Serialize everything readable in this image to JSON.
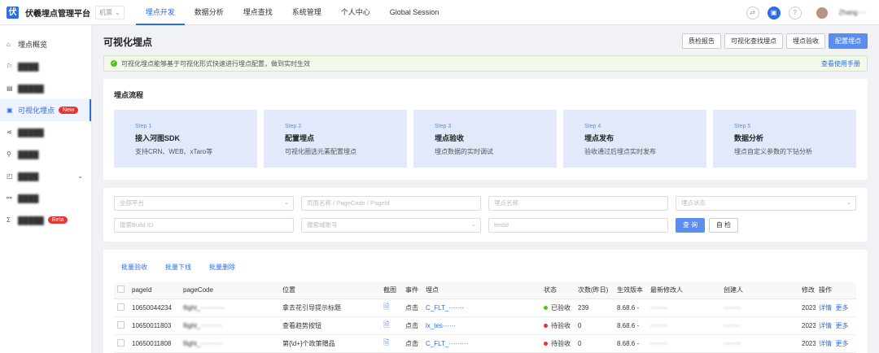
{
  "topbar": {
    "logo": "伏",
    "title": "伏羲埋点管理平台",
    "env": "机票",
    "nav": [
      "埋点开发",
      "数据分析",
      "埋点查找",
      "系统管理",
      "个人中心",
      "Global Session"
    ],
    "user": "Zhang····"
  },
  "sidebar": {
    "items": [
      {
        "label": "埋点概览",
        "icon": "home-icon"
      },
      {
        "label": "████",
        "icon": "flag-icon"
      },
      {
        "label": "█████",
        "icon": "doc-icon"
      },
      {
        "label": "可视化埋点",
        "icon": "eye-icon",
        "badge": "New"
      },
      {
        "label": "█████",
        "icon": "share-icon"
      },
      {
        "label": "████",
        "icon": "tree-icon"
      },
      {
        "label": "████",
        "icon": "chart-icon"
      },
      {
        "label": "████",
        "icon": "link-icon"
      },
      {
        "label": "█████",
        "icon": "sigma-icon",
        "badge": "Beta"
      }
    ]
  },
  "page": {
    "title": "可视化埋点",
    "buttons": [
      "质检报告",
      "可视化查找埋点",
      "埋点验收",
      "配置埋点"
    ]
  },
  "notice": {
    "text": "可视化埋点能够基于可视化形式快速进行埋点配置，做到实时生效",
    "link": "查看使用手册"
  },
  "flow": {
    "title": "埋点流程",
    "steps": [
      {
        "no": "Step 1",
        "name": "接入河图SDK",
        "desc": "支持CRN、WEB、xTaro等"
      },
      {
        "no": "Step 2",
        "name": "配置埋点",
        "desc": "可视化圈选元素配置埋点"
      },
      {
        "no": "Step 3",
        "name": "埋点验收",
        "desc": "埋点数据的实时调试"
      },
      {
        "no": "Step 4",
        "name": "埋点发布",
        "desc": "验收通过后埋点实时发布"
      },
      {
        "no": "Step 5",
        "name": "数据分析",
        "desc": "埋点自定义参数的下钻分析"
      }
    ]
  },
  "filters": {
    "platform": "全部平台",
    "page": "页面名称 / PageCode / PageId",
    "name": "埋点名称",
    "status": "埋点状态",
    "build": "搜索Build ID",
    "account": "搜索域账号",
    "testid": "testid",
    "query": "查 询",
    "selfcheck": "自 检"
  },
  "bulk": [
    "批量验收",
    "批量下线",
    "批量删除"
  ],
  "table": {
    "headers": [
      "pageId",
      "pageCode",
      "位置",
      "截图",
      "事件",
      "埋点",
      "状态",
      "次数(昨日)",
      "生效版本",
      "最新修改人",
      "创建人",
      "修改",
      "操作"
    ],
    "rows": [
      {
        "pageId": "10650044234",
        "pageCode": "flight_···········",
        "pos": "拿去花引导提示标题",
        "event": "点击",
        "point": "C_FLT_·······",
        "status": "已验收",
        "status_color": "green",
        "count": "239",
        "ver": "8.68.6 -",
        "modifier": "········",
        "creator": "········",
        "mod": "2023",
        "op1": "详情",
        "op2": "更多"
      },
      {
        "pageId": "10650011803",
        "pageCode": "flight_··········",
        "pos": "查看趋势按钮",
        "event": "点击",
        "point": "lx_tes······",
        "status": "待验收",
        "status_color": "red",
        "count": "0",
        "ver": "8.68.6 -",
        "modifier": "········",
        "creator": "········",
        "mod": "2023",
        "op1": "详情",
        "op2": "更多"
      },
      {
        "pageId": "10650011808",
        "pageCode": "flight_··········",
        "pos": "第{\\d+}个政策赠品",
        "event": "点击",
        "point": "C_FLT_·········",
        "status": "待验收",
        "status_color": "red",
        "count": "0",
        "ver": "8.68.6 -",
        "modifier": "········",
        "creator": "········",
        "mod": "2023",
        "op1": "详情",
        "op2": "更多"
      }
    ]
  },
  "colors": {
    "primary": "#2f6de5",
    "button": "#5b8def",
    "step_bg": "#e1e9fb",
    "danger": "#e63535",
    "success": "#52c41a"
  }
}
